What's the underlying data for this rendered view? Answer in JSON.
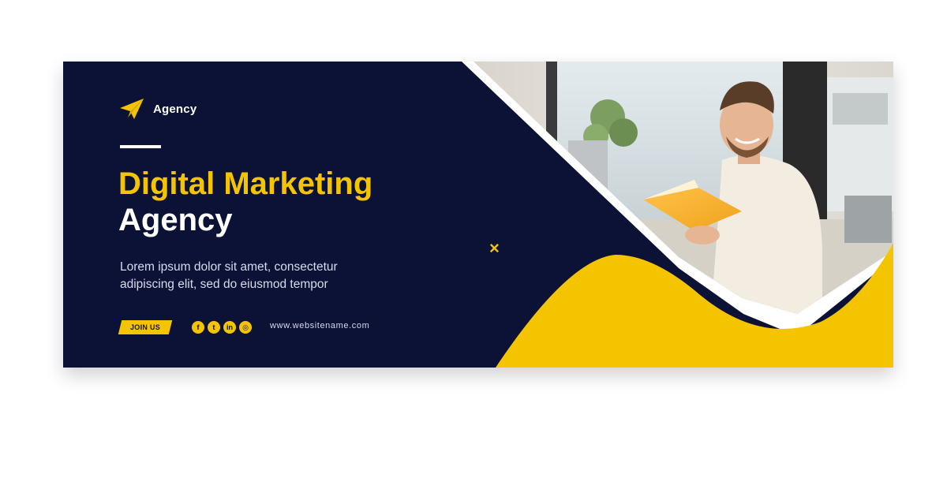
{
  "banner": {
    "logo": {
      "text": "Agency",
      "icon": "paper-plane-icon"
    },
    "headline_line1": "Digital Marketing",
    "headline_line2": "Agency",
    "description_line1": "Lorem ipsum dolor sit amet, consectetur",
    "description_line2": "adipiscing elit, sed do eiusmod tempor",
    "join_button": "JOIN US",
    "social_icons": [
      {
        "name": "facebook-icon",
        "glyph": "f"
      },
      {
        "name": "twitter-icon",
        "glyph": "t"
      },
      {
        "name": "linkedin-icon",
        "glyph": "in"
      },
      {
        "name": "instagram-icon",
        "glyph": "◎"
      }
    ],
    "website": "www.websitename.com",
    "decoration": "×"
  },
  "colors": {
    "navy": "#0b1236",
    "yellow": "#f5c400",
    "white": "#ffffff"
  }
}
